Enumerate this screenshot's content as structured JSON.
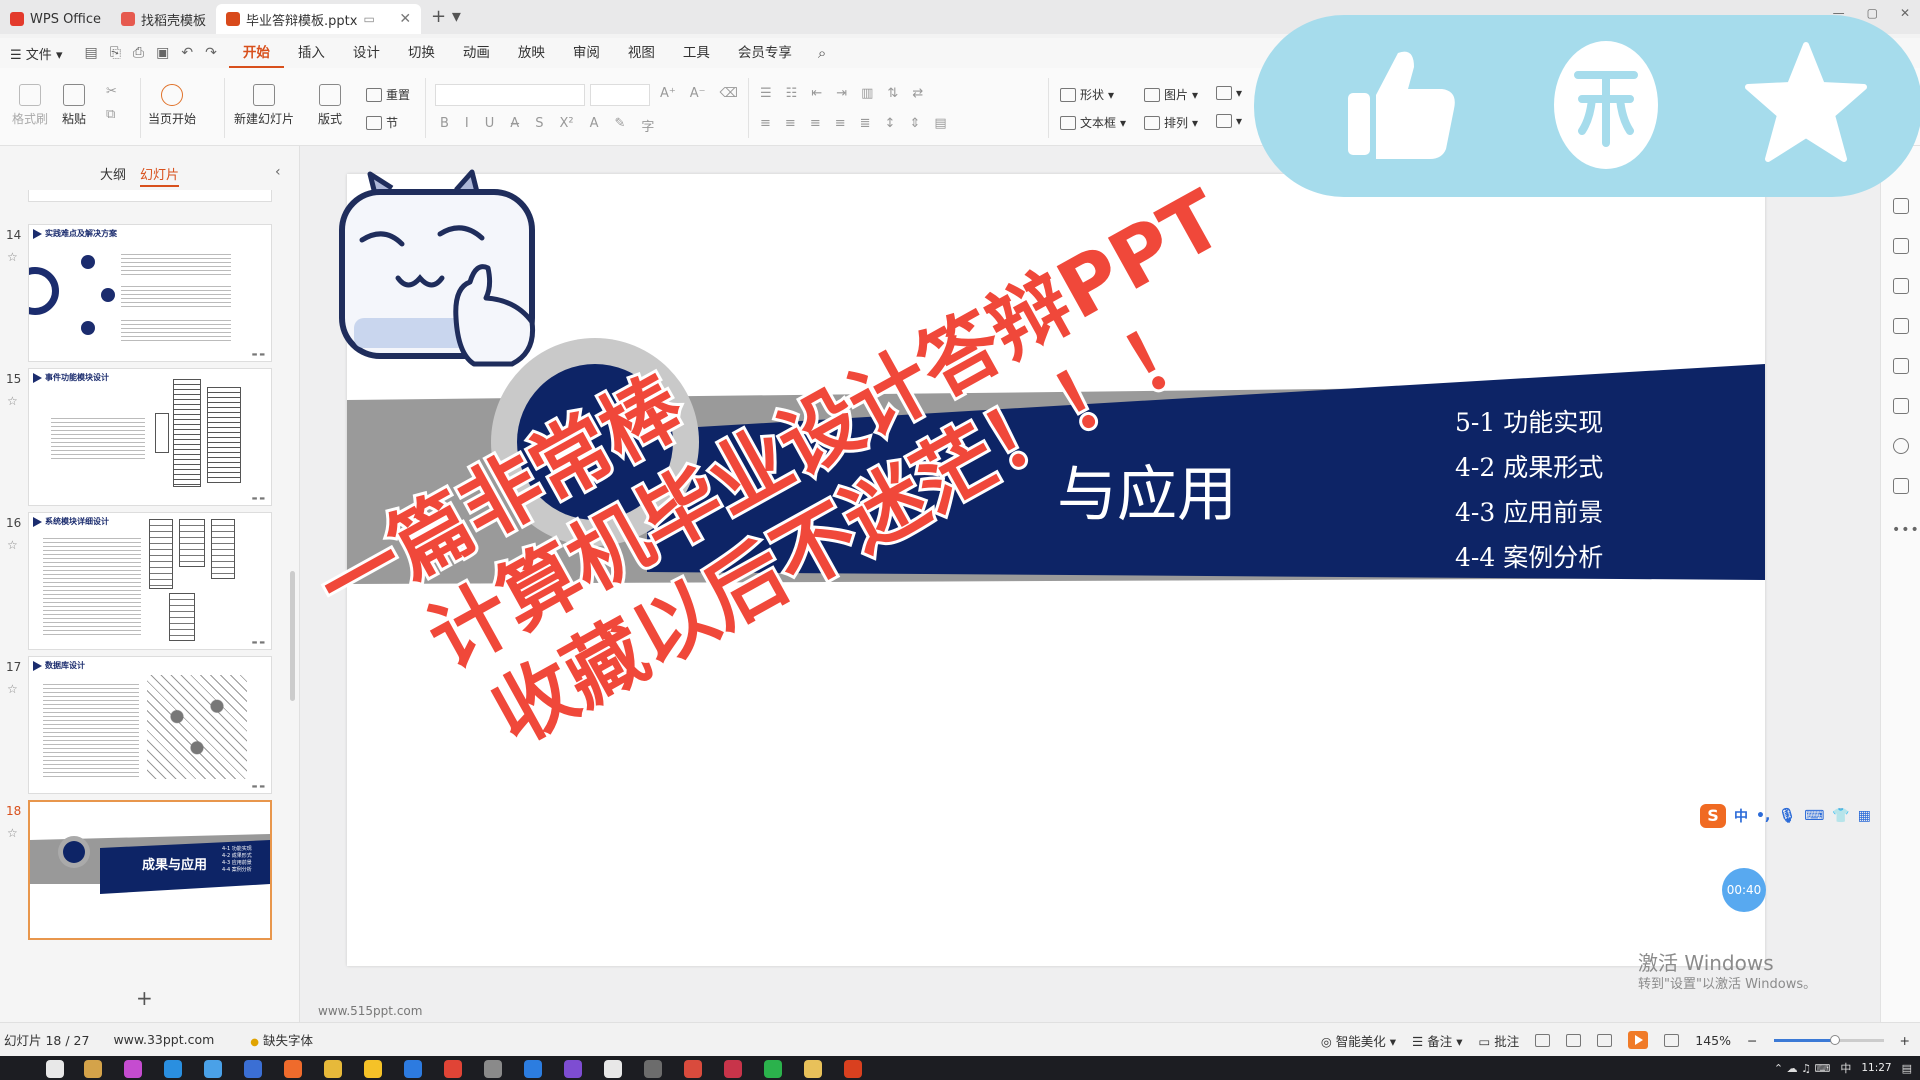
{
  "tabs": [
    {
      "label": "WPS Office",
      "active": false,
      "color": "#e33a2c"
    },
    {
      "label": "找稻壳模板",
      "active": false,
      "color": "#e65a4f"
    },
    {
      "label": "毕业答辩模板.pptx",
      "active": true,
      "color": "#d84a1b"
    }
  ],
  "menu": {
    "file": "文件",
    "items": [
      "开始",
      "插入",
      "设计",
      "切换",
      "动画",
      "放映",
      "审阅",
      "视图",
      "工具",
      "会员专享"
    ],
    "active": "开始"
  },
  "ribbon": {
    "format_painter": "格式刷",
    "paste": "粘贴",
    "from_current": "当页开始",
    "new_slide": "新建幻灯片",
    "layout": "版式",
    "reset": "重置",
    "section": "节",
    "shape": "形状",
    "picture": "图片",
    "textbox": "文本框",
    "arrange": "排列"
  },
  "left_panel": {
    "tab_outline": "大纲",
    "tab_slides": "幻灯片",
    "slides": [
      {
        "num": "14",
        "title": "实践难点及解决方案"
      },
      {
        "num": "15",
        "title": "事件功能模块设计"
      },
      {
        "num": "16",
        "title": "系统模块详细设计"
      },
      {
        "num": "17",
        "title": "数据库设计"
      },
      {
        "num": "18",
        "title": "成果与应用",
        "active": true,
        "items": [
          "4-1 功能实现",
          "4-2 成果形式",
          "4-3 应用前景",
          "4-4 案例分析"
        ]
      }
    ]
  },
  "slide": {
    "title_visible": "与应用",
    "items": [
      "5-1  功能实现",
      "4-2  成果形式",
      "4-3  应用前景",
      "4-4  案例分析"
    ],
    "navy": "#0d2466"
  },
  "canvas_watermark": "www.515ppt.com",
  "overlay": {
    "line1": "一篇非常棒",
    "line2": "计算机毕业设计答辩PPT",
    "line3": "收藏以后不迷茫！！！",
    "accent": "#f0483a",
    "badge_bg": "#a6dcec"
  },
  "timer": "00:40",
  "ime_label": "中",
  "activate_windows": {
    "line1": "激活 Windows",
    "line2": "转到\"设置\"以激活 Windows。"
  },
  "status": {
    "slide_info": "幻灯片 18 / 27",
    "site": "www.33ppt.com",
    "missing_font": "缺失字体",
    "smart": "智能美化",
    "notes": "备注",
    "comments": "批注",
    "zoom": "145%"
  },
  "taskbar": {
    "time": "11:27",
    "ime": "中"
  }
}
